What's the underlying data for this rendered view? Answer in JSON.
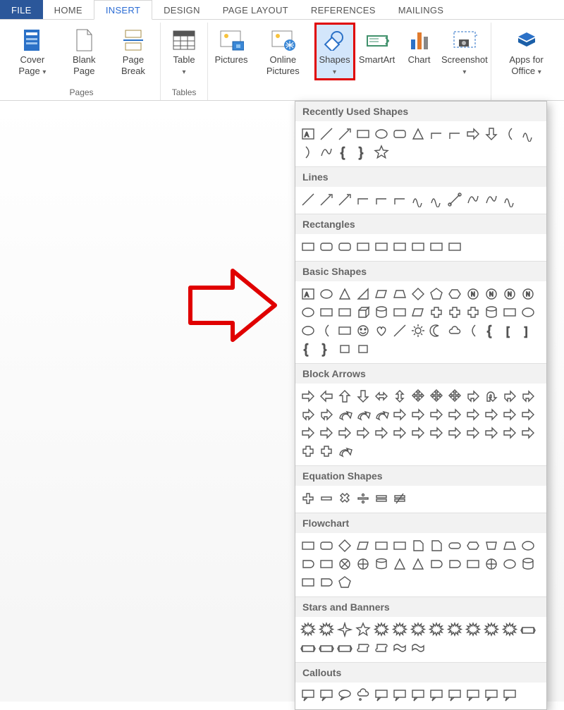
{
  "tabs": {
    "file": "FILE",
    "home": "HOME",
    "insert": "INSERT",
    "design": "DESIGN",
    "page_layout": "PAGE LAYOUT",
    "references": "REFERENCES",
    "mailings": "MAILINGS"
  },
  "ribbon": {
    "groups": [
      {
        "name": "pages",
        "label": "Pages",
        "items": [
          {
            "id": "cover-page",
            "label": "Cover Page",
            "dropdown": true
          },
          {
            "id": "blank-page",
            "label": "Blank Page",
            "dropdown": false
          },
          {
            "id": "page-break",
            "label": "Page Break",
            "dropdown": false
          }
        ]
      },
      {
        "name": "tables",
        "label": "Tables",
        "items": [
          {
            "id": "table",
            "label": "Table",
            "dropdown": true
          }
        ]
      },
      {
        "name": "illustrations",
        "label": "",
        "items": [
          {
            "id": "pictures",
            "label": "Pictures",
            "dropdown": false
          },
          {
            "id": "online-pictures",
            "label": "Online Pictures",
            "dropdown": false
          },
          {
            "id": "shapes",
            "label": "Shapes",
            "dropdown": true,
            "highlight": true
          },
          {
            "id": "smartart",
            "label": "SmartArt",
            "dropdown": false
          },
          {
            "id": "chart",
            "label": "Chart",
            "dropdown": false
          },
          {
            "id": "screenshot",
            "label": "Screenshot",
            "dropdown": true
          }
        ]
      },
      {
        "name": "apps",
        "label": "",
        "items": [
          {
            "id": "apps-for-office",
            "label": "Apps for Office",
            "dropdown": true
          }
        ]
      }
    ]
  },
  "shapes_dropdown": {
    "sections": [
      {
        "id": "recent",
        "label": "Recently Used Shapes",
        "count": 18
      },
      {
        "id": "lines",
        "label": "Lines",
        "count": 12
      },
      {
        "id": "rectangles",
        "label": "Rectangles",
        "count": 9
      },
      {
        "id": "basic",
        "label": "Basic Shapes",
        "count": 43
      },
      {
        "id": "block-arrows",
        "label": "Block Arrows",
        "count": 42
      },
      {
        "id": "equation",
        "label": "Equation Shapes",
        "count": 6
      },
      {
        "id": "flowchart",
        "label": "Flowchart",
        "count": 29
      },
      {
        "id": "stars",
        "label": "Stars and Banners",
        "count": 20
      },
      {
        "id": "callouts",
        "label": "Callouts",
        "count": 12
      }
    ]
  }
}
